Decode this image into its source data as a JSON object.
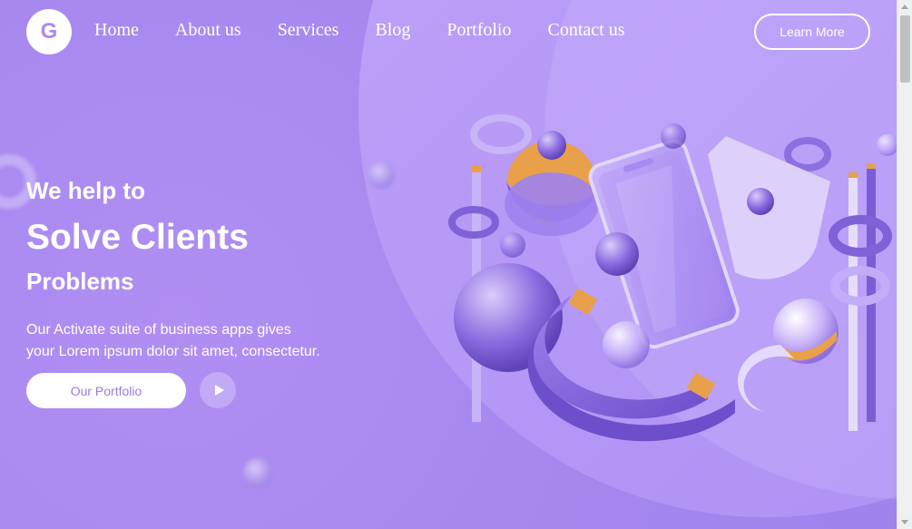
{
  "logo": {
    "letter": "G"
  },
  "nav": {
    "items": [
      {
        "label": "Home"
      },
      {
        "label": "About us"
      },
      {
        "label": "Services"
      },
      {
        "label": "Blog"
      },
      {
        "label": "Portfolio"
      },
      {
        "label": "Contact us"
      }
    ],
    "cta_label": "Learn More"
  },
  "hero": {
    "line1": "We help to",
    "line2": "Solve Clients",
    "line3": "Problems",
    "description_line1": "Our Activate suite of business apps gives",
    "description_line2": "your Lorem ipsum dolor sit amet, consectetur.",
    "portfolio_label": "Our Portfolio"
  },
  "icons": {
    "play": "play-icon",
    "illustration": "3d-phone-shapes-illustration"
  },
  "colors": {
    "background": "#a98af0",
    "accent_purple": "#8a6be0",
    "accent_orange": "#e9a04a",
    "white": "#ffffff"
  }
}
